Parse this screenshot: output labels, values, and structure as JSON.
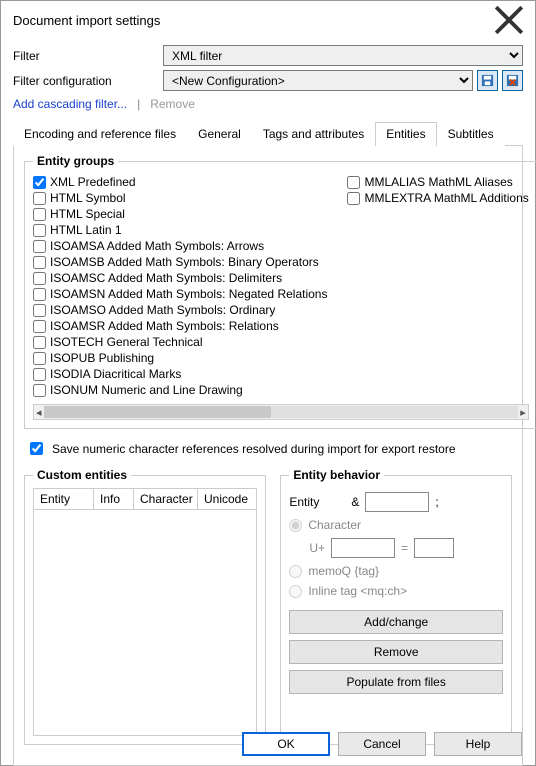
{
  "window": {
    "title": "Document import settings"
  },
  "filter": {
    "filter_label": "Filter",
    "filter_value": "XML filter",
    "config_label": "Filter configuration",
    "config_value": "<New Configuration>"
  },
  "links": {
    "add": "Add cascading filter...",
    "remove": "Remove"
  },
  "tabs": [
    {
      "id": "enc",
      "label": "Encoding and reference files"
    },
    {
      "id": "gen",
      "label": "General"
    },
    {
      "id": "tag",
      "label": "Tags and attributes"
    },
    {
      "id": "ent",
      "label": "Entities"
    },
    {
      "id": "sub",
      "label": "Subtitles"
    }
  ],
  "active_tab": "ent",
  "entity_groups": {
    "legend": "Entity groups",
    "left": [
      {
        "label": "XML Predefined",
        "checked": true
      },
      {
        "label": "HTML Symbol",
        "checked": false
      },
      {
        "label": "HTML Special",
        "checked": false
      },
      {
        "label": "HTML Latin 1",
        "checked": false
      },
      {
        "label": "ISOAMSA Added Math Symbols: Arrows",
        "checked": false
      },
      {
        "label": "ISOAMSB Added Math Symbols: Binary Operators",
        "checked": false
      },
      {
        "label": "ISOAMSC Added Math Symbols: Delimiters",
        "checked": false
      },
      {
        "label": "ISOAMSN Added Math Symbols: Negated Relations",
        "checked": false
      },
      {
        "label": "ISOAMSO Added Math Symbols: Ordinary",
        "checked": false
      },
      {
        "label": "ISOAMSR Added Math Symbols: Relations",
        "checked": false
      },
      {
        "label": "ISOTECH General Technical",
        "checked": false
      },
      {
        "label": "ISOPUB Publishing",
        "checked": false
      },
      {
        "label": "ISODIA Diacritical Marks",
        "checked": false
      },
      {
        "label": "ISONUM Numeric and Line Drawing",
        "checked": false
      }
    ],
    "right": [
      {
        "label": "MMLALIAS MathML Aliases",
        "checked": false
      },
      {
        "label": "MMLEXTRA MathML Additions",
        "checked": false
      }
    ]
  },
  "save_refs": {
    "label": "Save numeric character references resolved during import for export restore",
    "checked": true
  },
  "custom_entities": {
    "legend": "Custom entities",
    "cols": [
      "Entity",
      "Info",
      "Character",
      "Unicode"
    ]
  },
  "entity_behavior": {
    "legend": "Entity behavior",
    "entity_label": "Entity",
    "amp": "&",
    "semicolon": ";",
    "entity_value": "",
    "opt_char": "Character",
    "uplus": "U+",
    "eq": "=",
    "u_value": "",
    "eq_value": "",
    "opt_memoq": "memoQ {tag}",
    "opt_inline": "Inline tag <mq:ch>",
    "btn_add": "Add/change",
    "btn_remove": "Remove",
    "btn_populate": "Populate from files"
  },
  "footer": {
    "ok": "OK",
    "cancel": "Cancel",
    "help": "Help"
  }
}
